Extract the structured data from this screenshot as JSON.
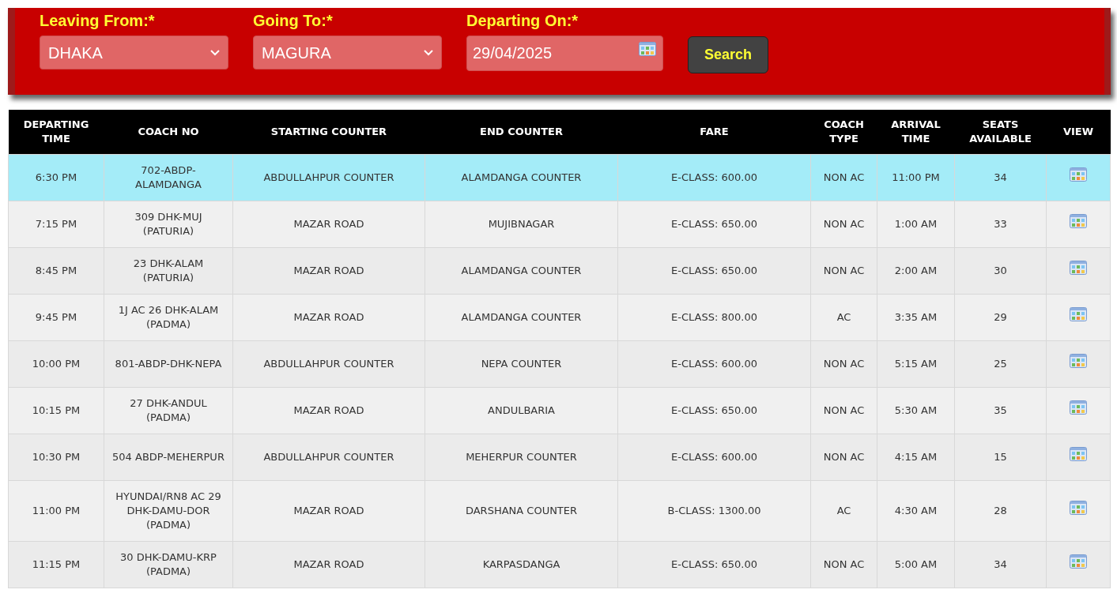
{
  "search_form": {
    "fields": [
      {
        "kind": "select",
        "label": "Leaving From:*",
        "value": "DHAKA"
      },
      {
        "kind": "select",
        "label": "Going To:*",
        "value": "MAGURA"
      },
      {
        "kind": "date",
        "label": "Departing On:*",
        "value": "29/04/2025"
      }
    ],
    "button": "Search"
  },
  "table": {
    "columns": [
      "DEPARTING TIME",
      "COACH NO",
      "STARTING COUNTER",
      "END COUNTER",
      "FARE",
      "COACH TYPE",
      "ARRIVAL TIME",
      "SEATS AVAILABLE",
      "VIEW"
    ],
    "rows": [
      {
        "selected": true,
        "cells": [
          "6:30 PM",
          "702-ABDP-ALAMDANGA",
          "ABDULLAHPUR COUNTER",
          "ALAMDANGA COUNTER",
          "E-CLASS: 600.00",
          "NON AC",
          "11:00 PM",
          "34"
        ]
      },
      {
        "selected": false,
        "cells": [
          "7:15 PM",
          "309 DHK-MUJ (PATURIA)",
          "MAZAR ROAD",
          "MUJIBNAGAR",
          "E-CLASS: 650.00",
          "NON AC",
          "1:00 AM",
          "33"
        ]
      },
      {
        "selected": false,
        "cells": [
          "8:45 PM",
          "23 DHK-ALAM (PATURIA)",
          "MAZAR ROAD",
          "ALAMDANGA COUNTER",
          "E-CLASS: 650.00",
          "NON AC",
          "2:00 AM",
          "30"
        ]
      },
      {
        "selected": false,
        "cells": [
          "9:45 PM",
          "1J AC 26 DHK-ALAM (PADMA)",
          "MAZAR ROAD",
          "ALAMDANGA COUNTER",
          "E-CLASS: 800.00",
          "AC",
          "3:35 AM",
          "29"
        ]
      },
      {
        "selected": false,
        "cells": [
          "10:00 PM",
          "801-ABDP-DHK-NEPA",
          "ABDULLAHPUR COUNTER",
          "NEPA COUNTER",
          "E-CLASS: 600.00",
          "NON AC",
          "5:15 AM",
          "25"
        ]
      },
      {
        "selected": false,
        "cells": [
          "10:15 PM",
          "27 DHK-ANDUL (PADMA)",
          "MAZAR ROAD",
          "ANDULBARIA",
          "E-CLASS: 650.00",
          "NON AC",
          "5:30 AM",
          "35"
        ]
      },
      {
        "selected": false,
        "cells": [
          "10:30 PM",
          "504 ABDP-MEHERPUR",
          "ABDULLAHPUR COUNTER",
          "MEHERPUR COUNTER",
          "E-CLASS: 600.00",
          "NON AC",
          "4:15 AM",
          "15"
        ]
      },
      {
        "selected": false,
        "cells": [
          "11:00 PM",
          "HYUNDAI/RN8 AC 29 DHK-DAMU-DOR (PADMA)",
          "MAZAR ROAD",
          "DARSHANA COUNTER",
          "B-CLASS: 1300.00",
          "AC",
          "4:30 AM",
          "28"
        ]
      },
      {
        "selected": false,
        "cells": [
          "11:15 PM",
          "30 DHK-DAMU-KRP (PADMA)",
          "MAZAR ROAD",
          "KARPASDANGA",
          "E-CLASS: 650.00",
          "NON AC",
          "5:00 AM",
          "34"
        ]
      }
    ]
  }
}
